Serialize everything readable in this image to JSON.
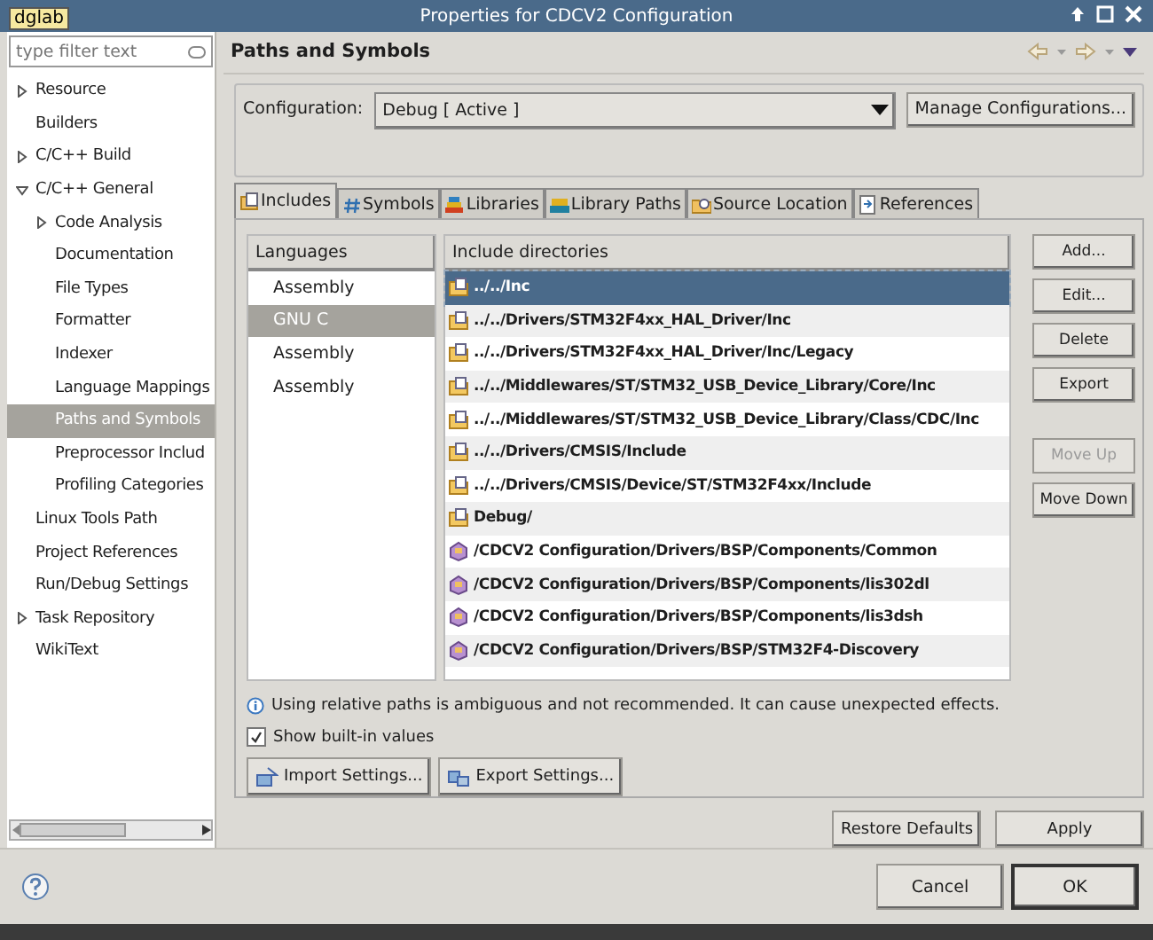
{
  "window": {
    "title": "Properties for CDCV2 Configuration"
  },
  "tooltip": "dglab",
  "filter": {
    "placeholder": "type filter text"
  },
  "tree": [
    {
      "label": "Resource",
      "expanded": false,
      "selected": false
    },
    {
      "label": "Builders",
      "selected": false
    },
    {
      "label": "C/C++ Build",
      "expanded": false,
      "selected": false
    },
    {
      "label": "C/C++ General",
      "expanded": true,
      "selected": false,
      "children": [
        {
          "label": "Code Analysis",
          "expanded": false,
          "selected": false
        },
        {
          "label": "Documentation",
          "selected": false
        },
        {
          "label": "File Types",
          "selected": false
        },
        {
          "label": "Formatter",
          "selected": false
        },
        {
          "label": "Indexer",
          "selected": false
        },
        {
          "label": "Language Mappings",
          "selected": false
        },
        {
          "label": "Paths and Symbols",
          "selected": true
        },
        {
          "label": "Preprocessor Includ",
          "selected": false
        },
        {
          "label": "Profiling Categories",
          "selected": false
        }
      ]
    },
    {
      "label": "Linux Tools Path",
      "selected": false
    },
    {
      "label": "Project References",
      "selected": false
    },
    {
      "label": "Run/Debug Settings",
      "selected": false
    },
    {
      "label": "Task Repository",
      "expanded": false,
      "selected": false
    },
    {
      "label": "WikiText",
      "selected": false
    }
  ],
  "page_title": "Paths and Symbols",
  "configuration": {
    "label": "Configuration:",
    "value": "Debug  [ Active ]",
    "button": "Manage Configurations..."
  },
  "tabs": [
    {
      "label": "Includes",
      "kind": "includes",
      "selected": true
    },
    {
      "label": "Symbols",
      "kind": "symbols",
      "selected": false
    },
    {
      "label": "Libraries",
      "kind": "libraries",
      "selected": false
    },
    {
      "label": "Library Paths",
      "kind": "librarypaths",
      "selected": false
    },
    {
      "label": "Source Location",
      "kind": "source",
      "selected": false
    },
    {
      "label": "References",
      "kind": "references",
      "selected": false
    }
  ],
  "languages": {
    "heading": "Languages",
    "items": [
      {
        "label": "Assembly",
        "selected": false
      },
      {
        "label": "GNU C",
        "selected": true
      },
      {
        "label": "Assembly",
        "selected": false
      },
      {
        "label": "Assembly",
        "selected": false
      }
    ]
  },
  "includes": {
    "heading": "Include directories",
    "rows": [
      {
        "path": "../../Inc",
        "kind": "folder",
        "selected": true
      },
      {
        "path": "../../Drivers/STM32F4xx_HAL_Driver/Inc",
        "kind": "folder",
        "selected": false
      },
      {
        "path": "../../Drivers/STM32F4xx_HAL_Driver/Inc/Legacy",
        "kind": "folder",
        "selected": false
      },
      {
        "path": "../../Middlewares/ST/STM32_USB_Device_Library/Core/Inc",
        "kind": "folder",
        "selected": false
      },
      {
        "path": "../../Middlewares/ST/STM32_USB_Device_Library/Class/CDC/Inc",
        "kind": "folder",
        "selected": false
      },
      {
        "path": "../../Drivers/CMSIS/Include",
        "kind": "folder",
        "selected": false
      },
      {
        "path": "../../Drivers/CMSIS/Device/ST/STM32F4xx/Include",
        "kind": "folder",
        "selected": false
      },
      {
        "path": "Debug/",
        "kind": "folder",
        "selected": false
      },
      {
        "path": "/CDCV2 Configuration/Drivers/BSP/Components/Common",
        "kind": "project",
        "selected": false
      },
      {
        "path": "/CDCV2 Configuration/Drivers/BSP/Components/lis302dl",
        "kind": "project",
        "selected": false
      },
      {
        "path": "/CDCV2 Configuration/Drivers/BSP/Components/lis3dsh",
        "kind": "project",
        "selected": false
      },
      {
        "path": "/CDCV2 Configuration/Drivers/BSP/STM32F4-Discovery",
        "kind": "project",
        "selected": false
      }
    ]
  },
  "side_buttons": [
    {
      "label": "Add...",
      "disabled": false
    },
    {
      "label": "Edit...",
      "disabled": false
    },
    {
      "label": "Delete",
      "disabled": false
    },
    {
      "label": "Export",
      "disabled": false
    },
    {
      "label": "Move Up",
      "disabled": true
    },
    {
      "label": "Move Down",
      "disabled": false
    }
  ],
  "info": "Using relative paths is ambiguous and not recommended. It can cause unexpected effects.",
  "show_builtin": {
    "label": "Show built-in values",
    "checked": true
  },
  "settings_buttons": [
    "Import Settings...",
    "Export Settings..."
  ],
  "page_buttons": [
    "Restore Defaults",
    "Apply"
  ],
  "dialog_buttons": [
    "Cancel",
    "OK"
  ]
}
